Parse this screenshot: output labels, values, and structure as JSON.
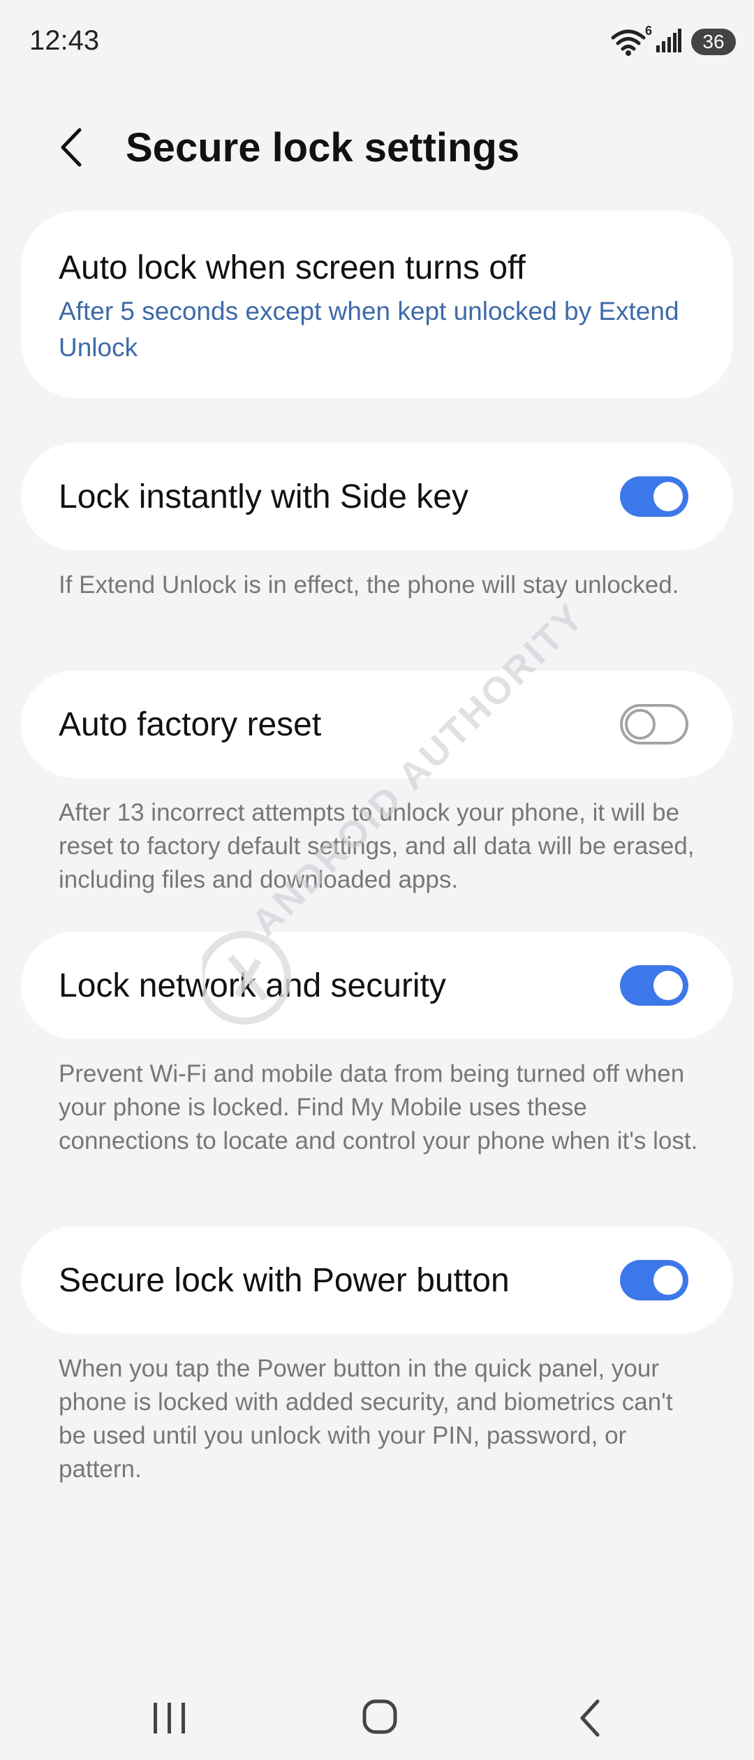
{
  "status_bar": {
    "time": "12:43",
    "wifi_label": "6",
    "battery": "36"
  },
  "header": {
    "title": "Secure lock settings"
  },
  "items": [
    {
      "title": "Auto lock when screen turns off",
      "subtitle": "After 5 seconds except when kept unlocked by Extend Unlock"
    },
    {
      "title": "Lock instantly with Side key",
      "toggle": true,
      "description": "If Extend Unlock is in effect, the phone will stay unlocked."
    },
    {
      "title": "Auto factory reset",
      "toggle": false,
      "description": "After 13 incorrect attempts to unlock your phone, it will be reset to factory default settings, and all data will be erased, including files and downloaded apps."
    },
    {
      "title": "Lock network and security",
      "toggle": true,
      "description": "Prevent Wi-Fi and mobile data from being turned off when your phone is locked. Find My Mobile uses these connections to locate and control your phone when it's lost."
    },
    {
      "title": "Secure lock with Power button",
      "toggle": true,
      "description": "When you tap the Power button in the quick panel, your phone is locked with added security, and biometrics can't be used until you unlock with your PIN, password, or pattern."
    }
  ],
  "watermark": "ANDROID AUTHORITY",
  "colors": {
    "accent": "#3d78ea",
    "link": "#3d6aa8",
    "toggle_off": "#a3a3a7",
    "background": "#f4f4f6"
  },
  "icons": {
    "back": "chevron-left-icon",
    "wifi": "wifi-icon",
    "signal": "signal-icon",
    "battery": "battery-icon",
    "recents": "recents-icon",
    "home": "home-icon",
    "nav_back": "nav-back-icon"
  }
}
